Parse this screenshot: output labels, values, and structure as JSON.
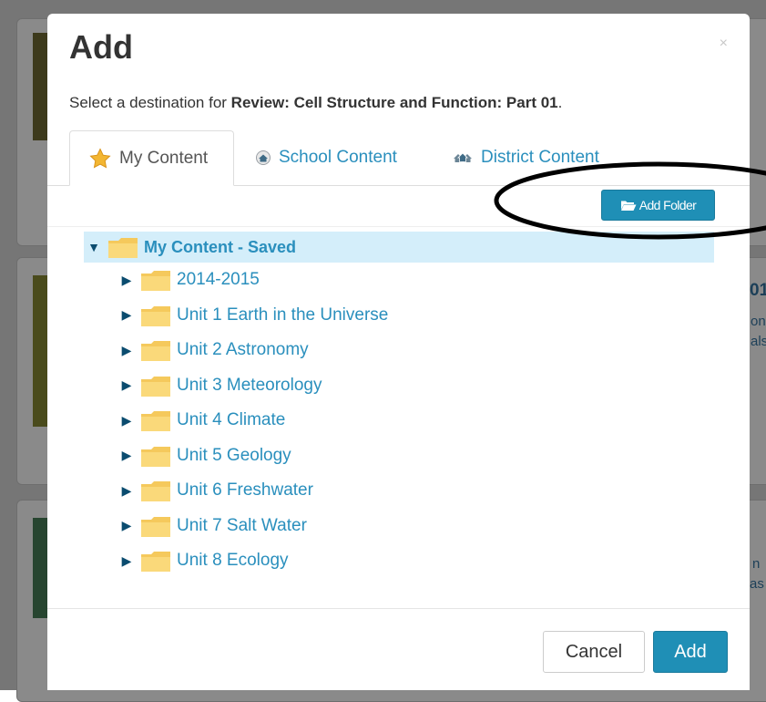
{
  "modal": {
    "title": "Add",
    "close_glyph": "×",
    "subtitle_prefix": "Select a destination for ",
    "subtitle_item": "Review: Cell Structure and Function: Part 01",
    "subtitle_suffix": ".",
    "tabs": [
      {
        "label": "My Content",
        "icon": "star-icon",
        "active": true
      },
      {
        "label": "School Content",
        "icon": "school-icon",
        "active": false
      },
      {
        "label": "District Content",
        "icon": "district-icon",
        "active": false
      }
    ],
    "add_folder_label": "Add Folder",
    "tree": {
      "root_label": "My Content - Saved",
      "root_expanded": true,
      "children": [
        "2014-2015",
        "Unit 1 Earth in the Universe",
        "Unit 2 Astronomy",
        "Unit 3 Meteorology",
        "Unit 4 Climate",
        "Unit 5 Geology",
        "Unit 6 Freshwater",
        "Unit 7 Salt Water",
        "Unit 8 Ecology"
      ]
    },
    "footer": {
      "cancel_label": "Cancel",
      "add_label": "Add"
    }
  },
  "background": {
    "text_fragments": [
      "01",
      "on",
      "als",
      "n",
      "as"
    ]
  },
  "colors": {
    "primary": "#1f8fb6",
    "link": "#2a8fbd",
    "selected_row": "#d4eefa",
    "folder": "#f5c95c",
    "caret": "#0b4c6f"
  }
}
